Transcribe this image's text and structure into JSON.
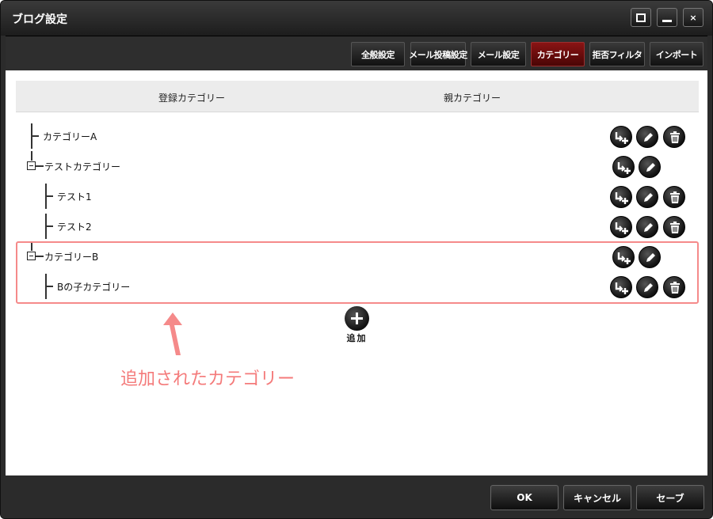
{
  "window": {
    "title": "ブログ設定",
    "close_glyph": "×"
  },
  "tabs": [
    {
      "label": "全般設定",
      "active": false
    },
    {
      "label": "メール投稿設定",
      "active": false
    },
    {
      "label": "メール設定",
      "active": false
    },
    {
      "label": "カテゴリー",
      "active": true
    },
    {
      "label": "拒否フィルタ",
      "active": false
    },
    {
      "label": "インポート",
      "active": false
    }
  ],
  "table": {
    "headers": {
      "registered": "登録カテゴリー",
      "parent": "親カテゴリー"
    },
    "rows": [
      {
        "label": "カテゴリーA",
        "level": 0,
        "expandable": false,
        "actions": [
          "add-child",
          "edit",
          "delete"
        ]
      },
      {
        "label": "テストカテゴリー",
        "level": 0,
        "expandable": true,
        "actions": [
          "add-child",
          "edit"
        ]
      },
      {
        "label": "テスト1",
        "level": 1,
        "expandable": false,
        "actions": [
          "add-child",
          "edit",
          "delete"
        ]
      },
      {
        "label": "テスト2",
        "level": 1,
        "expandable": false,
        "actions": [
          "add-child",
          "edit",
          "delete"
        ]
      },
      {
        "label": "カテゴリーB",
        "level": 0,
        "expandable": true,
        "actions": [
          "add-child",
          "edit"
        ]
      },
      {
        "label": "Bの子カテゴリー",
        "level": 1,
        "expandable": false,
        "actions": [
          "add-child",
          "edit",
          "delete"
        ]
      }
    ]
  },
  "add_button": {
    "label": "追加"
  },
  "annotation": {
    "text": "追加されたカテゴリー",
    "color": "#f47a7a"
  },
  "footer": {
    "ok": "OK",
    "cancel": "キャンセル",
    "save": "セーブ"
  },
  "colors": {
    "active_tab": "#6e0c0c",
    "chrome": "#2b2b2b",
    "highlight_border": "#f58a8a"
  },
  "icons": {
    "add_child": "add-child-icon",
    "edit": "pencil-icon",
    "delete": "trash-icon"
  }
}
